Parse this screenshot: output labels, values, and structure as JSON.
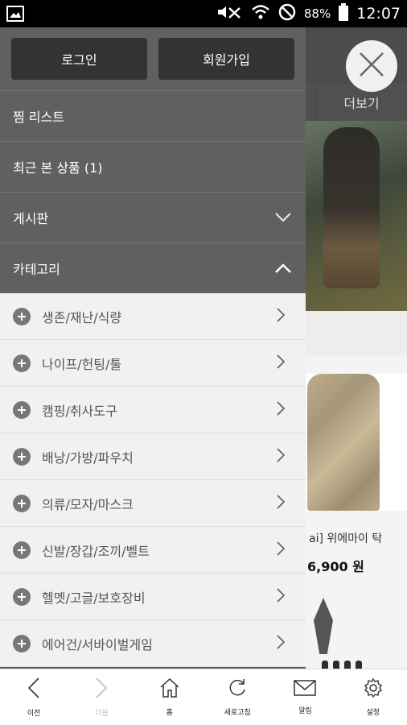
{
  "status_bar": {
    "battery": "88%",
    "time": "12:07"
  },
  "background": {
    "tab_more": "더보기",
    "product_name": "ai] 위에마이 탁",
    "product_price": "6,900 원"
  },
  "drawer": {
    "login_label": "로그인",
    "signup_label": "회원가입",
    "menu": [
      {
        "label": "찜 리스트"
      },
      {
        "label": "최근 본 상품 (1)"
      },
      {
        "label": "게시판",
        "icon": "chevron-down-icon"
      },
      {
        "label": "카테고리",
        "icon": "chevron-up-icon"
      }
    ],
    "categories": [
      "생존/재난/식량",
      "나이프/헌팅/툴",
      "캠핑/취사도구",
      "배낭/가방/파우치",
      "의류/모자/마스크",
      "신발/장갑/조끼/벨트",
      "헬멧/고글/보호장비",
      "에어건/서바이벌게임"
    ]
  },
  "bottom_nav": [
    {
      "label": "이전",
      "icon": "back-icon"
    },
    {
      "label": "다음",
      "icon": "forward-icon"
    },
    {
      "label": "홈",
      "icon": "home-icon"
    },
    {
      "label": "새로고침",
      "icon": "refresh-icon"
    },
    {
      "label": "알림",
      "icon": "mail-icon"
    },
    {
      "label": "설정",
      "icon": "settings-icon"
    }
  ],
  "colors": {
    "drawer_bg": "#606060",
    "auth_button_bg": "#333333",
    "category_bg": "#f1f1f1"
  }
}
